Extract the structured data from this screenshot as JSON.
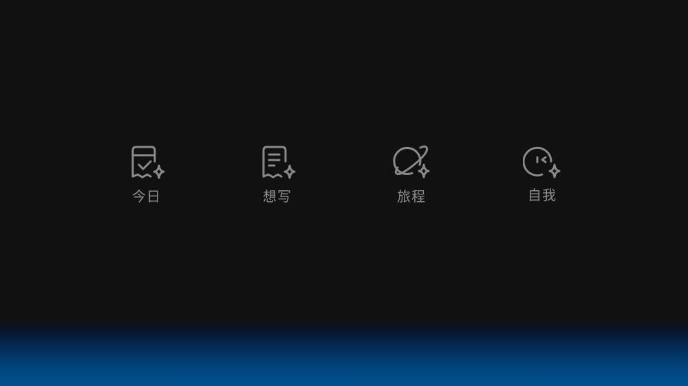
{
  "tabbar": {
    "items": [
      {
        "label": "今日",
        "icon": "calendar-check-sparkle-icon"
      },
      {
        "label": "想写",
        "icon": "note-sparkle-icon"
      },
      {
        "label": "旅程",
        "icon": "planet-sparkle-icon"
      },
      {
        "label": "自我",
        "icon": "wink-face-sparkle-icon"
      }
    ]
  },
  "colors": {
    "background": "#111111",
    "icon": "#8a8a8a",
    "label": "#8f8f8f",
    "glow": "#00508c"
  }
}
